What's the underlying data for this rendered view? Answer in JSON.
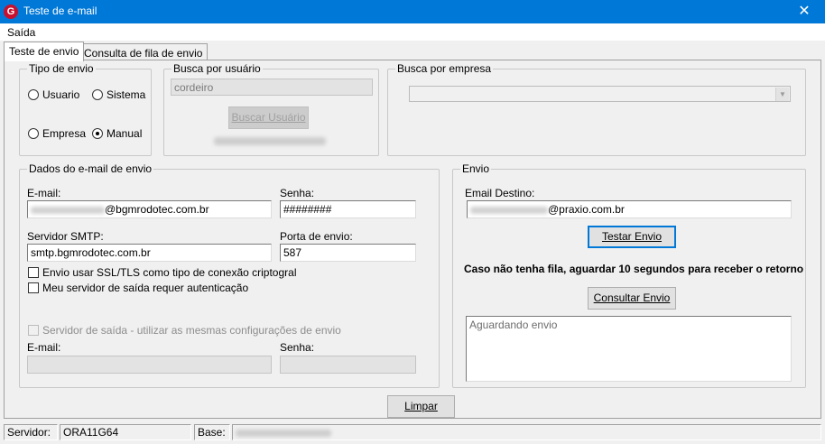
{
  "window": {
    "title": "Teste de e-mail",
    "close_glyph": "✕",
    "app_icon_letter": "G",
    "app_icon": "app-logo-icon"
  },
  "menu": {
    "items": [
      {
        "label": "Saída"
      }
    ]
  },
  "tabs": [
    {
      "label": "Teste de envio",
      "active": true
    },
    {
      "label": "Consulta de fila de envio",
      "active": false
    }
  ],
  "tipo_envio": {
    "title": "Tipo de envio",
    "options": [
      {
        "label": "Usuario",
        "checked": false
      },
      {
        "label": "Sistema",
        "checked": false
      },
      {
        "label": "Empresa",
        "checked": false
      },
      {
        "label": "Manual",
        "checked": true
      }
    ]
  },
  "busca_usuario": {
    "title": "Busca por usuário",
    "value": "cordeiro",
    "button": "Buscar Usuário"
  },
  "busca_empresa": {
    "title": "Busca por empresa",
    "value": ""
  },
  "dados": {
    "title": "Dados do e-mail de envio",
    "email_label": "E-mail:",
    "email_suffix": "@bgmrodotec.com.br",
    "senha_label": "Senha:",
    "senha_value": "########",
    "smtp_label": "Servidor SMTP:",
    "smtp_value": "smtp.bgmrodotec.com.br",
    "porta_label": "Porta de envio:",
    "porta_value": "587",
    "ssl_label": "Envio usar SSL/TLS como tipo de conexão criptogral",
    "ssl_checked": false,
    "auth_label": "Meu servidor de saída requer autenticação",
    "auth_checked": false,
    "saida_label": "Servidor de saída - utilizar as mesmas configurações de envio",
    "saida_email_label": "E-mail:",
    "saida_senha_label": "Senha:"
  },
  "envio": {
    "title": "Envio",
    "destino_label": "Email Destino:",
    "destino_suffix": "@praxio.com.br",
    "testar_button": "Testar Envio",
    "info_text": "Caso não tenha fila, aguardar 10 segundos para receber o retorno",
    "consultar_button": "Consultar Envio",
    "log_text": "Aguardando envio"
  },
  "footer": {
    "limpar_button": "Limpar"
  },
  "status": {
    "servidor_label": "Servidor:",
    "servidor_value": "ORA11G64",
    "base_label": "Base:"
  }
}
